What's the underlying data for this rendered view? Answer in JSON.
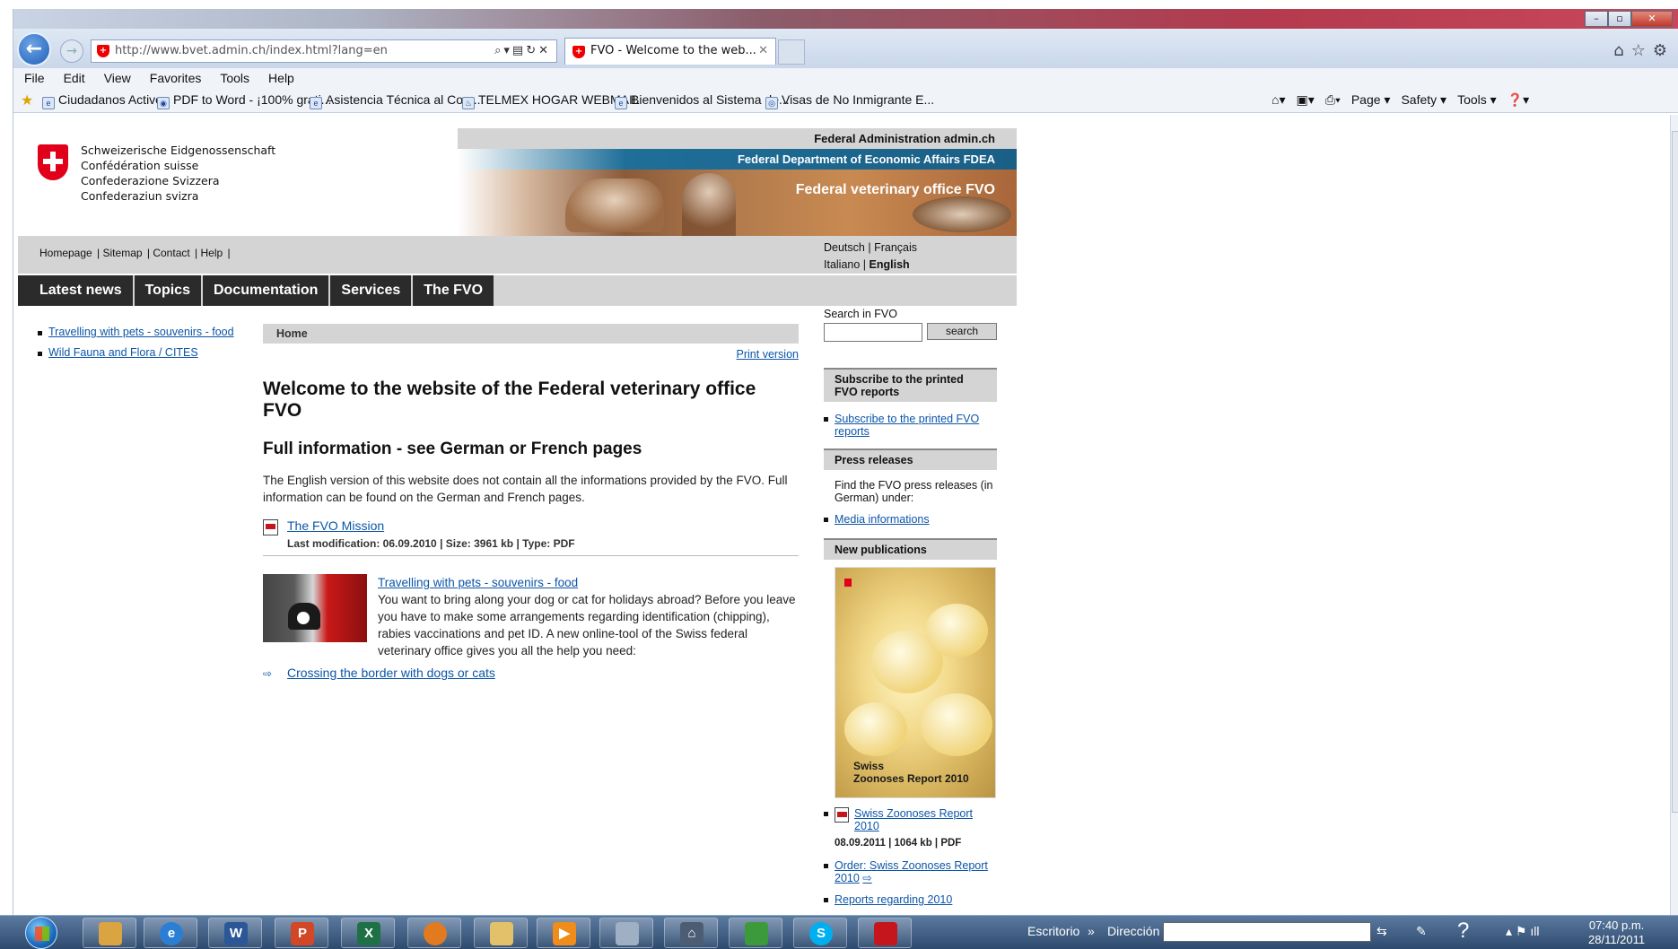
{
  "browser": {
    "url": "http://www.bvet.admin.ch/index.html?lang=en",
    "tab_title": "FVO - Welcome to the web...",
    "menu": [
      "File",
      "Edit",
      "View",
      "Favorites",
      "Tools",
      "Help"
    ],
    "favorites": [
      "Ciudadanos Activos",
      "PDF to Word - ¡100% grati...",
      "Asistencia Técnica al Com...",
      "TELMEX HOGAR  WEBMAIL",
      "Bienvenidos al Sistema de...",
      "Visas de No Inmigrante  E..."
    ],
    "commands": [
      "Page ▾",
      "Safety ▾",
      "Tools ▾"
    ]
  },
  "header": {
    "brand_lines": [
      "Schweizerische Eidgenossenschaft",
      "Confédération suisse",
      "Confederazione Svizzera",
      "Confederaziun svizra"
    ],
    "admin_label": "Federal Administration admin.ch",
    "department": "Federal Department of Economic Affairs FDEA",
    "office": "Federal veterinary office FVO"
  },
  "utility": {
    "links": [
      "Homepage",
      "Sitemap",
      "Contact",
      "Help"
    ],
    "languages": {
      "deutsch": "Deutsch",
      "francais": "Français",
      "italiano": "Italiano",
      "english": "English"
    }
  },
  "main_nav": [
    "Latest news",
    "Topics",
    "Documentation",
    "Services",
    "The FVO"
  ],
  "left_nav": [
    "Travelling with pets - souvenirs - food",
    "Wild Fauna and Flora / CITES"
  ],
  "content": {
    "breadcrumb": "Home",
    "print_version": "Print version",
    "heading": "Welcome to the website of the Federal veterinary office FVO",
    "subheading": "Full information - see German or French pages",
    "intro": "The English version of this website does not contain all the informations provided by the FVO. Full information can be found on the German and French pages.",
    "doc_link": "The FVO Mission",
    "doc_meta": "Last modification: 06.09.2010 | Size: 3961 kb | Type: PDF",
    "teaser_title": "Travelling with pets - souvenirs - food",
    "teaser_text": "You want to bring along your dog or cat for holidays abroad? Before you leave you have to make some arrangements regarding identification (chipping), rabies vaccinations and pet ID. A new online-tool of the Swiss federal veterinary office gives you all the help you need:",
    "ext_link": "Crossing the border with dogs or cats"
  },
  "sidebar": {
    "search_label": "Search in FVO",
    "search_button": "search",
    "subscribe_head": "Subscribe to the printed FVO reports",
    "subscribe_link": "Subscribe to the printed FVO reports",
    "press_head": "Press releases",
    "press_text": "Find the FVO press releases (in German) under:",
    "press_link": "Media informations",
    "pub_head": "New publications",
    "cover_title_1": "Swiss",
    "cover_title_2": "Zoonoses Report 2010",
    "pub_link": "Swiss Zoonoses Report 2010",
    "pub_meta": "08.09.2011 | 1064 kb | PDF",
    "order_link": "Order: Swiss Zoonoses Report 2010",
    "reports_link": "Reports regarding 2010"
  },
  "taskbar": {
    "desktop_label": "Escritorio",
    "address_label": "Dirección",
    "time": "07:40 p.m.",
    "date": "28/11/2011"
  }
}
